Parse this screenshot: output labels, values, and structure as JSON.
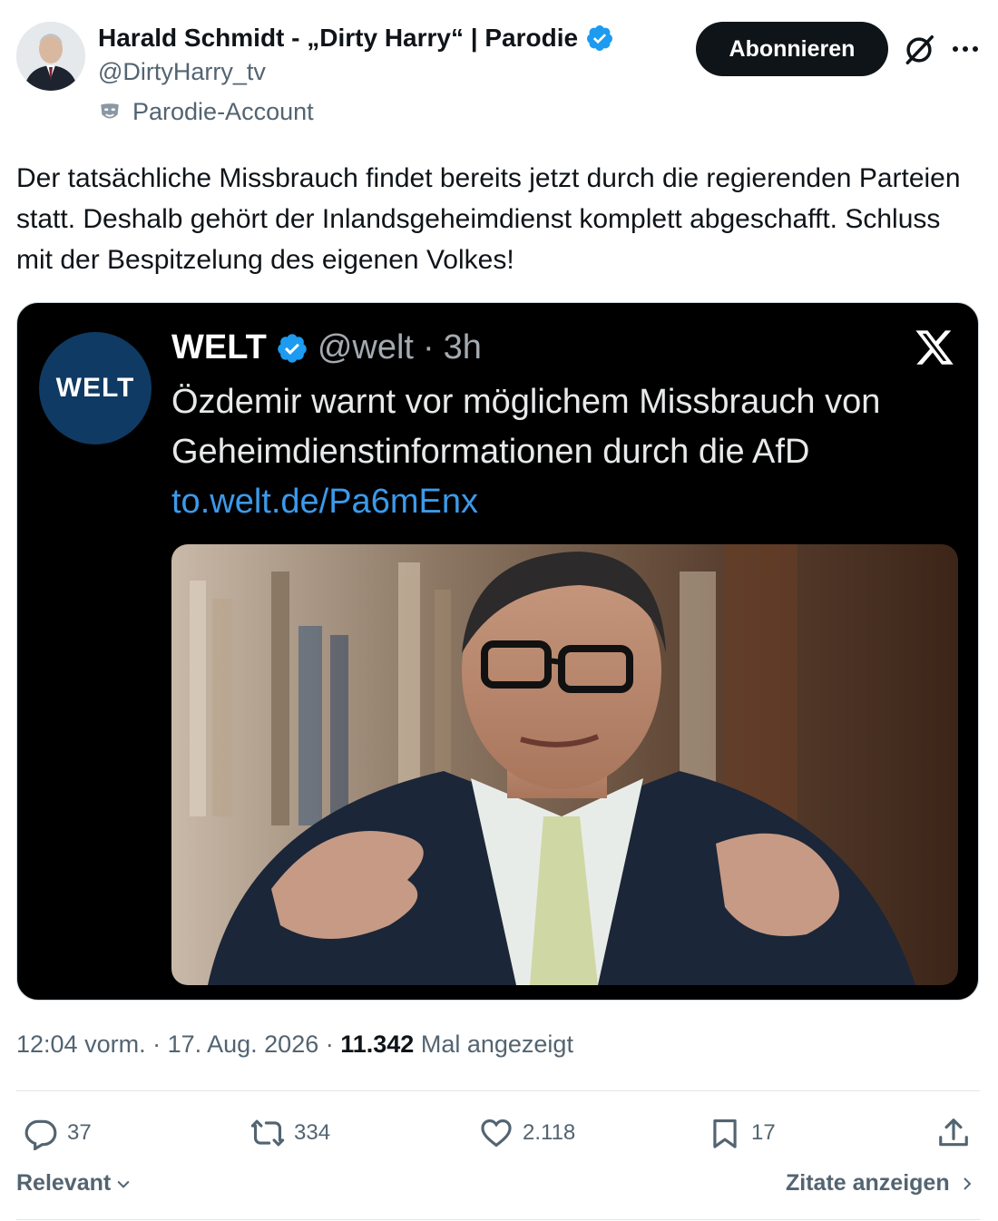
{
  "header": {
    "display_name": "Harald Schmidt - „Dirty Harry“ | Parodie",
    "handle": "@DirtyHarry_tv",
    "parody_label": "Parodie-Account",
    "subscribe_label": "Abonnieren"
  },
  "tweet": {
    "text": "Der tatsächliche Missbrauch findet bereits jetzt durch die regierenden Parteien statt. Deshalb gehört der Inlandsgeheimdienst komplett abgeschafft. Schluss mit der Bespitzelung des eigenen Volkes!"
  },
  "embedded": {
    "logo_text": "WELT",
    "name": "WELT",
    "handle": "@welt",
    "separator": "·",
    "age": "3h",
    "text": "Özdemir warnt vor möglichem Missbrauch von Geheimdienstinformationen durch die AfD",
    "link": "to.welt.de/Pa6mEnx"
  },
  "meta": {
    "time": "12:04 vorm.",
    "dot1": " · ",
    "date": "17. Aug. 2026",
    "dot2": " · ",
    "views": "11.342",
    "views_label": "Mal angezeigt"
  },
  "actions": {
    "replies": "37",
    "reposts": "334",
    "likes": "2.118",
    "bookmarks": "17"
  },
  "footer": {
    "sort_label": "Relevant",
    "quotes_label": "Zitate anzeigen"
  },
  "colors": {
    "verified": "#1d9bf0",
    "muted": "#536471",
    "link": "#3b9aeb"
  }
}
